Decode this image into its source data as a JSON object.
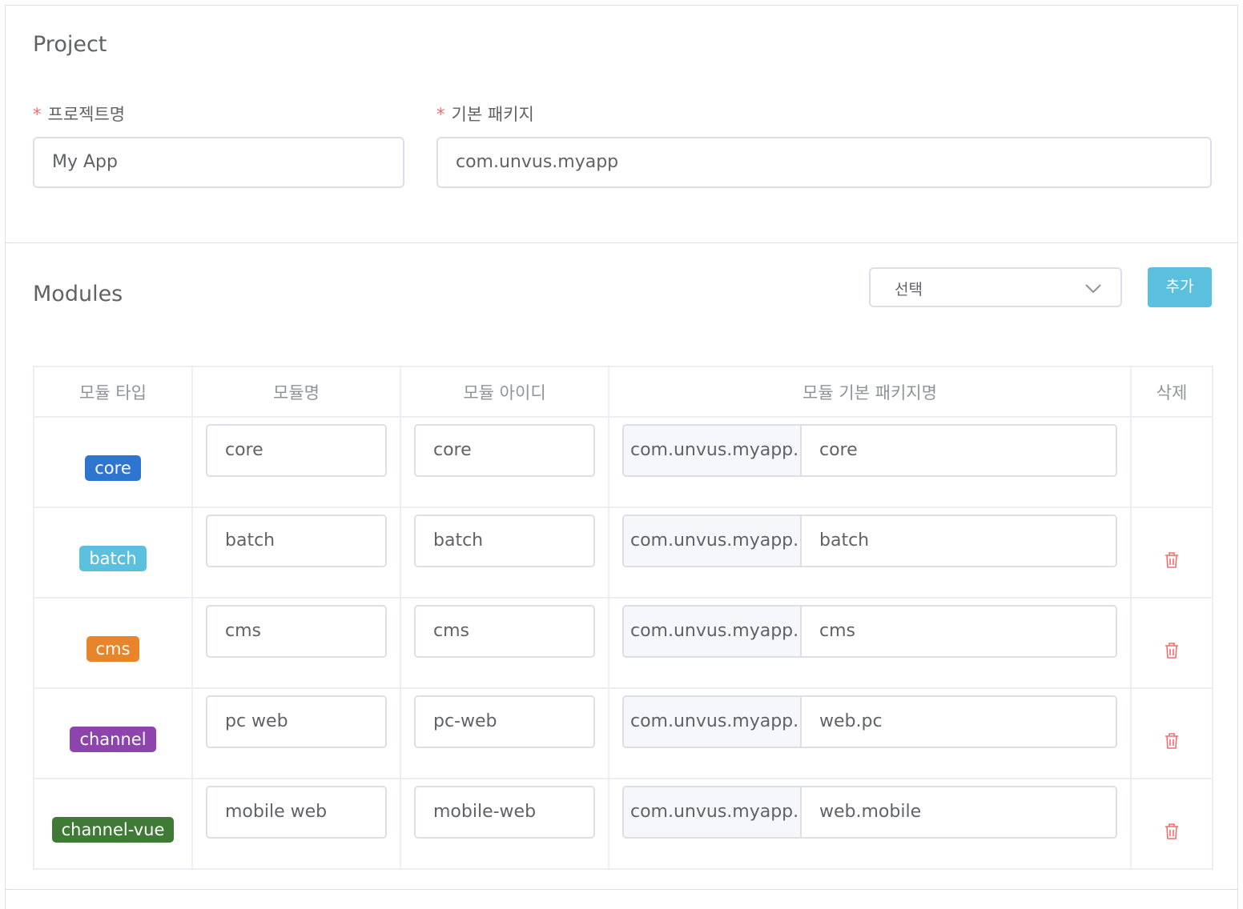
{
  "project": {
    "title": "Project",
    "name_label": "프로젝트명",
    "name_value": "My App",
    "package_label": "기본 패키지",
    "package_value": "com.unvus.myapp"
  },
  "modules": {
    "title": "Modules",
    "select_value": "선택",
    "add_label": "추가",
    "columns": [
      "모듈 타입",
      "모듈명",
      "모듈 아이디",
      "모듈 기본 패키지명",
      "삭제"
    ],
    "rows": [
      {
        "type": "core",
        "type_color": "#2e75cf",
        "name": "core",
        "id": "core",
        "prefix": "com.unvus.myapp.",
        "suffix": "core",
        "deletable": false
      },
      {
        "type": "batch",
        "type_color": "#5bc0de",
        "name": "batch",
        "id": "batch",
        "prefix": "com.unvus.myapp.",
        "suffix": "batch",
        "deletable": true
      },
      {
        "type": "cms",
        "type_color": "#e8852a",
        "name": "cms",
        "id": "cms",
        "prefix": "com.unvus.myapp.",
        "suffix": "cms",
        "deletable": true
      },
      {
        "type": "channel",
        "type_color": "#8e44ad",
        "name": "pc web",
        "id": "pc-web",
        "prefix": "com.unvus.myapp.",
        "suffix": "web.pc",
        "deletable": true
      },
      {
        "type": "channel-vue",
        "type_color": "#3f7a36",
        "name": "mobile web",
        "id": "mobile-web",
        "prefix": "com.unvus.myapp.",
        "suffix": "web.mobile",
        "deletable": true
      }
    ],
    "colors": {
      "danger": "#f56c6c",
      "accent": "#5bc0de"
    },
    "icons": {
      "select": "chevron-down-icon",
      "delete": "trash-icon"
    }
  }
}
